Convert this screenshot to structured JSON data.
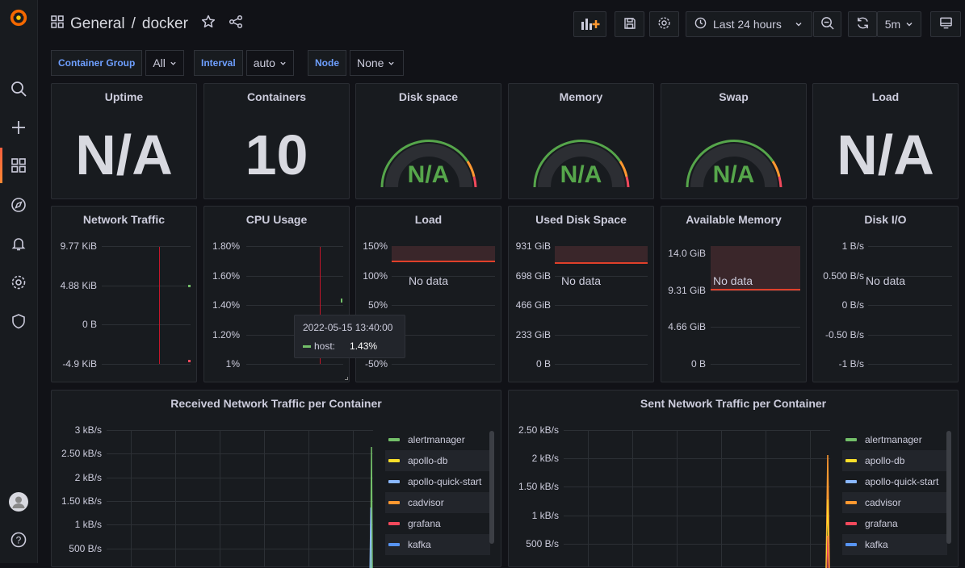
{
  "header": {
    "folder": "General",
    "separator": "/",
    "dashboard": "docker",
    "time_range": "Last 24 hours",
    "refresh": "5m"
  },
  "variables": [
    {
      "label": "Container Group",
      "value": "All"
    },
    {
      "label": "Interval",
      "value": "auto"
    },
    {
      "label": "Node",
      "value": "None"
    }
  ],
  "stats": {
    "uptime": {
      "title": "Uptime",
      "value": "N/A"
    },
    "containers": {
      "title": "Containers",
      "value": "10"
    },
    "disk_space": {
      "title": "Disk space",
      "value": "N/A"
    },
    "memory": {
      "title": "Memory",
      "value": "N/A"
    },
    "swap": {
      "title": "Swap",
      "value": "N/A"
    },
    "load": {
      "title": "Load",
      "value": "N/A"
    }
  },
  "row2": {
    "network_traffic": {
      "title": "Network Traffic",
      "ticks": [
        "9.77 KiB",
        "4.88 KiB",
        "0 B",
        "-4.9 KiB"
      ]
    },
    "cpu_usage": {
      "title": "CPU Usage",
      "ticks": [
        "1.80%",
        "1.60%",
        "1.40%",
        "1.20%",
        "1%"
      ]
    },
    "load": {
      "title": "Load",
      "ticks": [
        "150%",
        "100%",
        "50%",
        "",
        "-50%"
      ],
      "nodata": "No data"
    },
    "used_disk": {
      "title": "Used Disk Space",
      "ticks": [
        "931 GiB",
        "698 GiB",
        "466 GiB",
        "233 GiB",
        "0 B"
      ],
      "nodata": "No data"
    },
    "avail_mem": {
      "title": "Available Memory",
      "ticks": [
        "14.0 GiB",
        "9.31 GiB",
        "4.66 GiB",
        "0 B"
      ],
      "nodata": "No data"
    },
    "disk_io": {
      "title": "Disk I/O",
      "ticks": [
        "1 B/s",
        "0.500 B/s",
        "0 B/s",
        "-0.50 B/s",
        "-1 B/s"
      ],
      "nodata": "No data"
    }
  },
  "tooltip": {
    "time": "2022-05-15 13:40:00",
    "series": "host:",
    "value": "1.43%"
  },
  "received": {
    "title": "Received Network Traffic per Container",
    "ticks": [
      "3 kB/s",
      "2.50 kB/s",
      "2 kB/s",
      "1.50 kB/s",
      "1 kB/s",
      "500 B/s"
    ]
  },
  "sent": {
    "title": "Sent Network Traffic per Container",
    "ticks": [
      "2.50 kB/s",
      "2 kB/s",
      "1.50 kB/s",
      "1 kB/s",
      "500 B/s"
    ]
  },
  "legend": [
    {
      "name": "alertmanager",
      "color": "#73bf69"
    },
    {
      "name": "apollo-db",
      "color": "#fade2a"
    },
    {
      "name": "apollo-quick-start",
      "color": "#8ab8ff"
    },
    {
      "name": "cadvisor",
      "color": "#ff9830"
    },
    {
      "name": "grafana",
      "color": "#f2495c"
    },
    {
      "name": "kafka",
      "color": "#5794f2"
    }
  ]
}
